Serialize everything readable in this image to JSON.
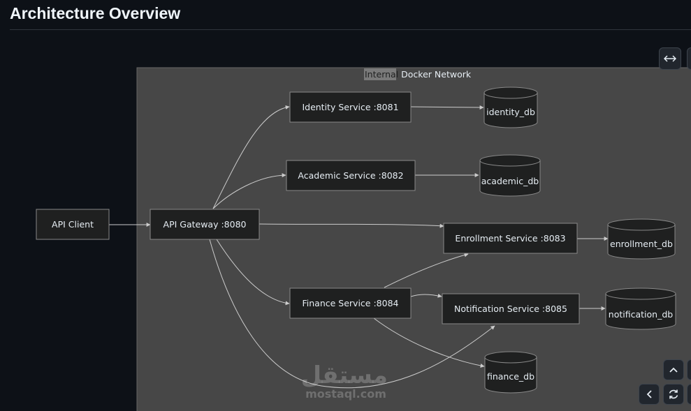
{
  "header": {
    "title": "Architecture Overview"
  },
  "diagram": {
    "subgraph": {
      "label_internal": "Internal",
      "label_rest": " Docker Network"
    },
    "nodes": {
      "api_client": "API Client",
      "api_gateway": "API Gateway :8080",
      "identity": "Identity Service :8081",
      "academic": "Academic Service :8082",
      "enrollment": "Enrollment Service :8083",
      "finance": "Finance Service :8084",
      "notification": "Notification Service :8085",
      "identity_db": "identity_db",
      "academic_db": "academic_db",
      "enrollment_db": "enrollment_db",
      "notification_db": "notification_db",
      "finance_db": "finance_db"
    },
    "colors": {
      "canvas": "#0d1117",
      "subgraph_fill": "#474747",
      "node_fill": "#1f2020",
      "edge": "#cccccc"
    }
  },
  "controls": {
    "expand_icon": "left-right-arrow-icon",
    "up_icon": "chevron-up-icon",
    "left_icon": "chevron-left-icon",
    "reset_icon": "refresh-icon"
  },
  "watermark": {
    "logo": "مستقل",
    "site": "mostaql.com"
  }
}
